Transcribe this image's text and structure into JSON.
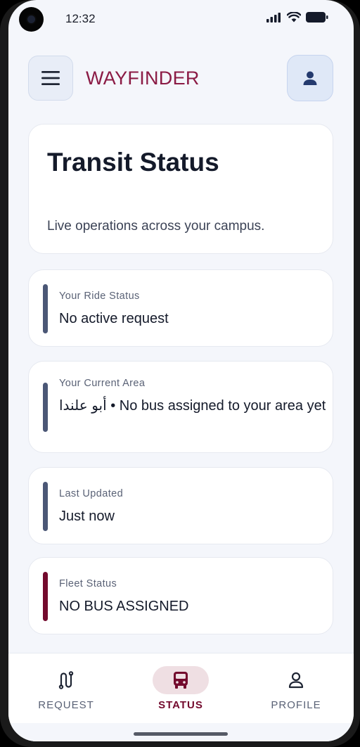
{
  "status_bar": {
    "time": "12:32",
    "icons": [
      "signal-icon",
      "wifi-icon",
      "battery-icon"
    ]
  },
  "header": {
    "brand": "WAYFINDER",
    "menu_icon": "hamburger-menu-icon",
    "profile_icon": "user-icon"
  },
  "hero": {
    "title": "Transit Status",
    "subtitle": "Live operations across your campus."
  },
  "cards": [
    {
      "label": "Your Ride Status",
      "value": "No active request",
      "accent": "#4b5776"
    },
    {
      "label": "Your Current Area",
      "value": "أبو علندا • No bus assigned to your area yet",
      "accent": "#4b5776"
    },
    {
      "label": "Last Updated",
      "value": "Just now",
      "accent": "#4b5776"
    },
    {
      "label": "Fleet Status",
      "value": "NO BUS ASSIGNED",
      "accent": "#730a2d"
    }
  ],
  "bottom_nav": {
    "items": [
      {
        "label": "REQUEST",
        "icon": "route-icon",
        "active": false
      },
      {
        "label": "STATUS",
        "icon": "bus-icon",
        "active": true
      },
      {
        "label": "PROFILE",
        "icon": "person-icon",
        "active": false
      }
    ]
  },
  "colors": {
    "brand": "#8b1b45",
    "accent_active": "#730a2d",
    "card_bar": "#4b5776",
    "background": "#f4f6fb"
  }
}
